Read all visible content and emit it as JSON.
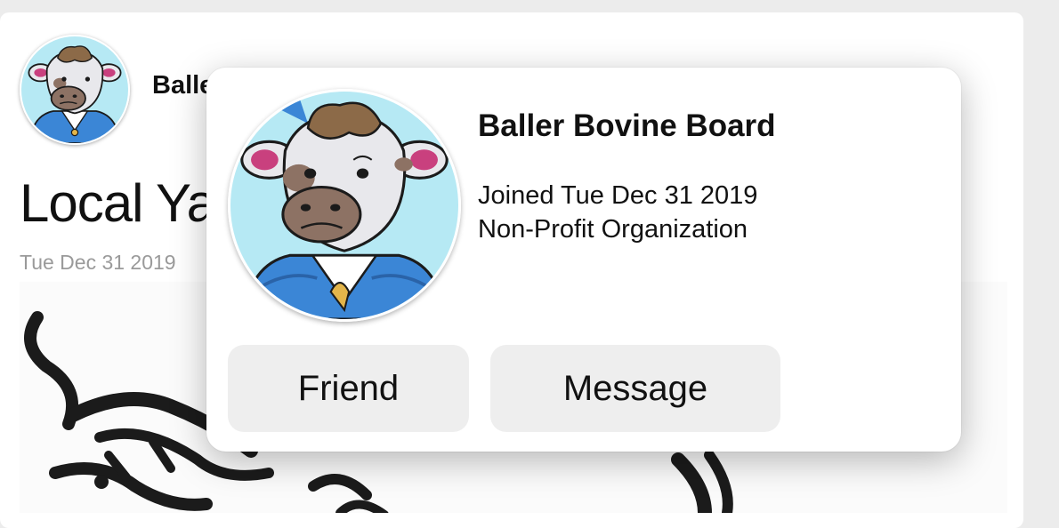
{
  "post": {
    "author": "Baller Bovine Board",
    "title": "Local Yak",
    "date": "Tue Dec 31 2019"
  },
  "popover": {
    "name": "Baller Bovine Board",
    "joined": "Joined Tue Dec 31 2019",
    "account_type": "Non-Profit Organization",
    "friend_label": "Friend",
    "message_label": "Message"
  },
  "colors": {
    "avatar_background": "#b6e9f4",
    "jacket_blue": "#3b86d6",
    "button_background": "#eeeeee",
    "date_gray": "#9a9a9a"
  }
}
